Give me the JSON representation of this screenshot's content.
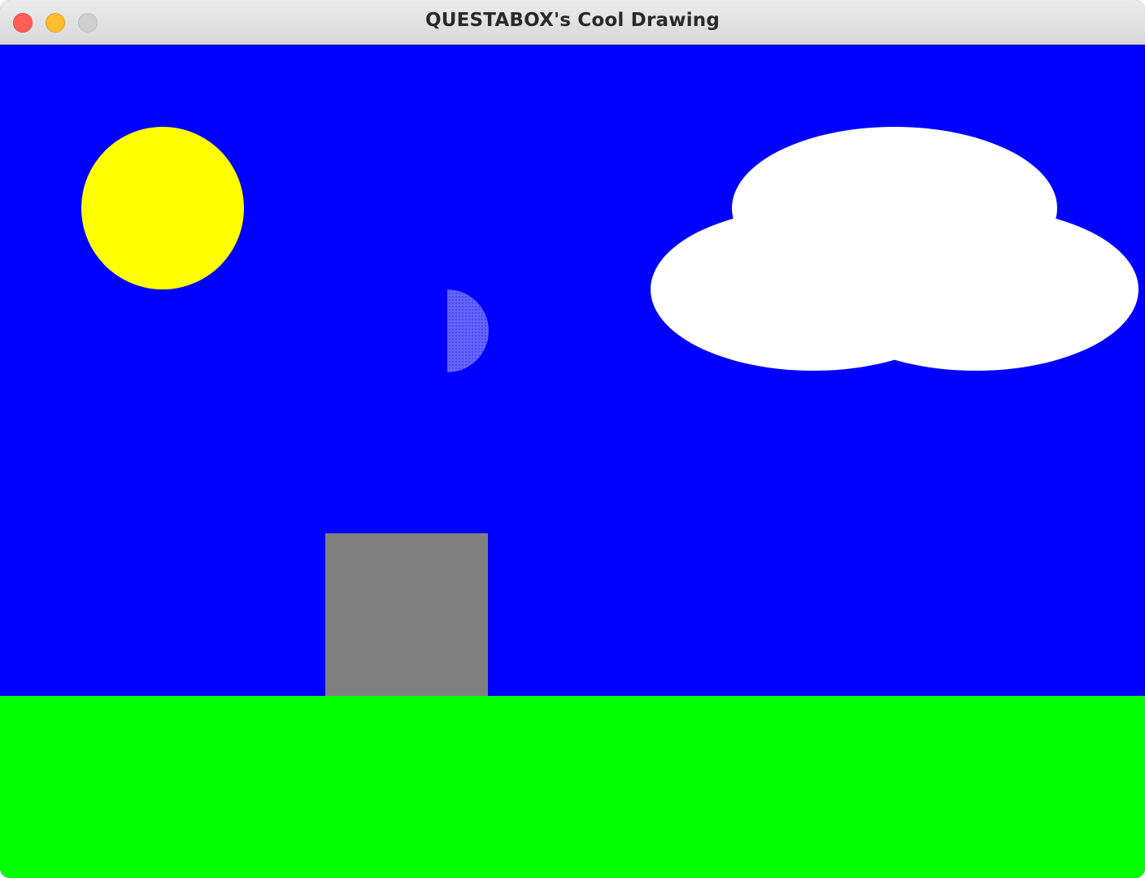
{
  "window": {
    "title": "QUESTABOX's Cool Drawing",
    "controls": [
      "close",
      "minimize",
      "zoom"
    ]
  },
  "drawing": {
    "sky_color": "#0000ff",
    "ground_color": "#00ff00",
    "sun_color": "#ffff00",
    "cloud_color": "#ffffff",
    "building_color": "#808080",
    "moon_color": "#5a5aff"
  }
}
